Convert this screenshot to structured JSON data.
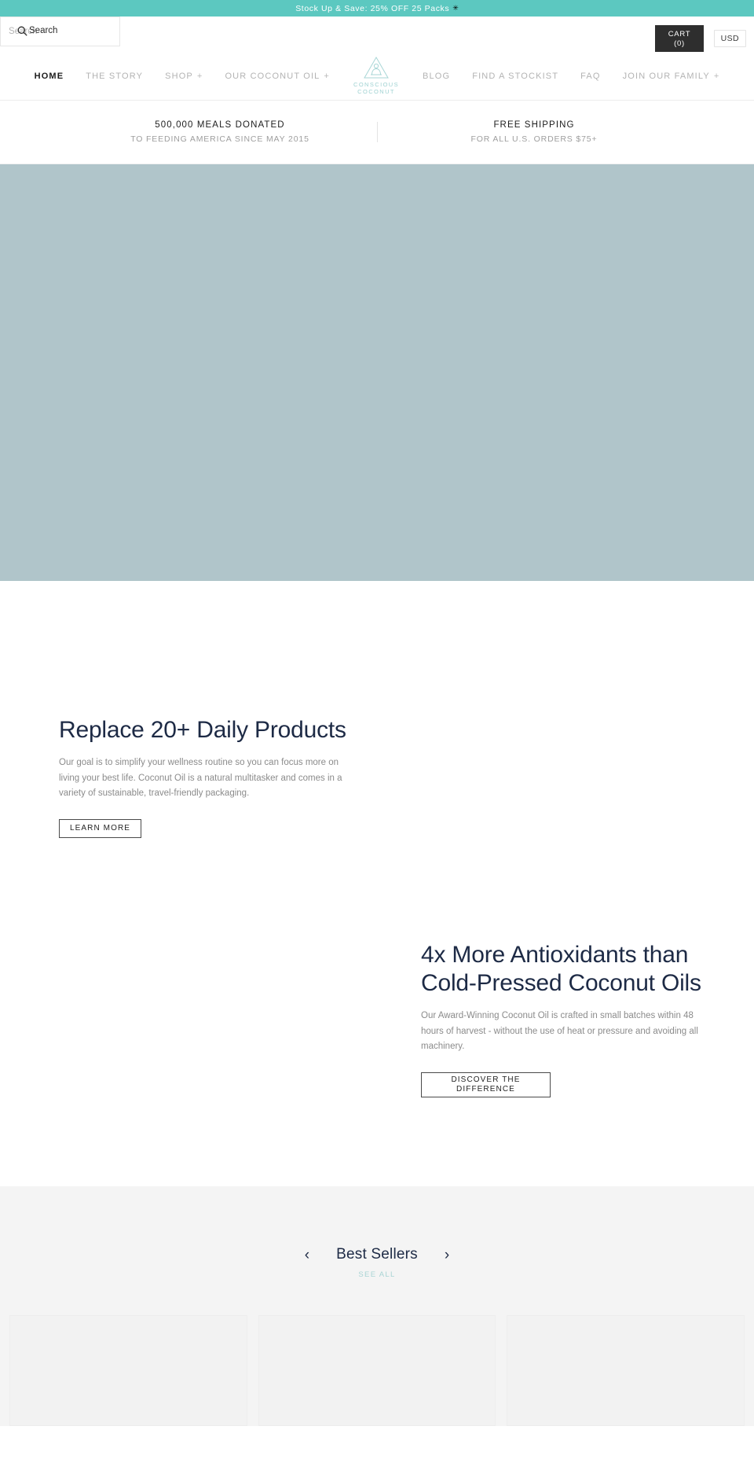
{
  "announcement": {
    "text": "Stock Up & Save: 25% OFF 25 Packs",
    "star": "✳"
  },
  "utility": {
    "search_placeholder": "Search",
    "search_value": "",
    "search_label": "Search",
    "search_icon": "search-icon",
    "cart_label": "CART",
    "cart_count": "(0)",
    "currency": "USD"
  },
  "nav": {
    "items": [
      {
        "label": "HOME",
        "plus": "",
        "active": true
      },
      {
        "label": "THE STORY",
        "plus": "",
        "active": false
      },
      {
        "label": "SHOP",
        "plus": "+",
        "active": false
      },
      {
        "label": "OUR COCONUT OIL",
        "plus": "+",
        "active": false
      }
    ],
    "items_right": [
      {
        "label": "BLOG",
        "plus": "",
        "active": false
      },
      {
        "label": "FIND A STOCKIST",
        "plus": "",
        "active": false
      },
      {
        "label": "FAQ",
        "plus": "",
        "active": false
      },
      {
        "label": "JOIN OUR FAMILY",
        "plus": "+",
        "active": false
      }
    ],
    "logo": {
      "line1": "CONSCIOUS",
      "line2": "COCONUT",
      "icon": "triangle-meditation-logo-icon",
      "color": "#9fd2d2"
    }
  },
  "promo": {
    "columns": [
      {
        "title": "500,000 MEALS DONATED",
        "subtitle": "TO FEEDING AMERICA SINCE MAY 2015"
      },
      {
        "title": "FREE SHIPPING",
        "subtitle": "FOR ALL U.S. ORDERS $75+"
      }
    ]
  },
  "hero": {
    "background_color": "#b0c5ca"
  },
  "features": [
    {
      "heading": "Replace 20+ Daily Products",
      "body": "Our goal is to simplify your wellness routine so you can focus more on living your best life. Coconut Oil is a natural multitasker and comes in a variety of sustainable, travel-friendly packaging.",
      "button": "LEARN MORE"
    },
    {
      "heading": "4x More Antioxidants than Cold-Pressed Coconut Oils",
      "body": "Our Award-Winning Coconut Oil is crafted in small batches within 48 hours of harvest - without the use of heat or pressure and avoiding all machinery.",
      "button_line1": "DISCOVER THE",
      "button_line2": "DIFFERENCE"
    }
  ],
  "bestsellers": {
    "title": "Best Sellers",
    "see_all": "SEE ALL",
    "prev_icon": "‹",
    "next_icon": "›",
    "cards": [
      "",
      "",
      ""
    ]
  },
  "colors": {
    "accent_teal": "#5cc8c0",
    "logo_teal": "#9fd2d2",
    "heading_navy": "#1d2a45",
    "hero_blue": "#b0c5ca",
    "panel_gray": "#f4f4f4"
  }
}
